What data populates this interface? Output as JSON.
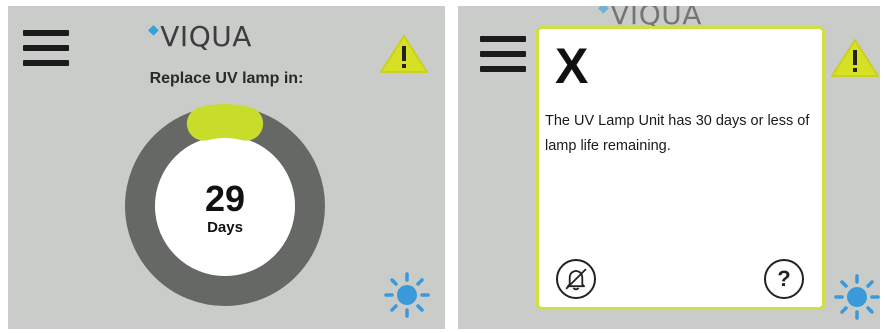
{
  "brand": {
    "name": "VIQUA",
    "drop_glyph": "💧"
  },
  "left_screen": {
    "title": "Replace UV lamp in:",
    "days_remaining": "29",
    "days_unit": "Days",
    "lamp_life_fraction_used": 0.08
  },
  "right_screen": {
    "dialog": {
      "close_label": "X",
      "message": "The UV Lamp Unit has 30 days or less of lamp life remaining.",
      "help_label": "?"
    }
  },
  "colors": {
    "screen_bg": "#c9ccc9",
    "ring_track": "#666866",
    "ring_progress": "#c8dc2c",
    "warning_fill": "#d6e024",
    "sun_blue": "#3a9ad9",
    "dialog_border": "#cfe040"
  },
  "icons": [
    "menu-icon",
    "warning-icon",
    "sun-icon",
    "close-x",
    "mute-bell-icon",
    "help-icon"
  ]
}
